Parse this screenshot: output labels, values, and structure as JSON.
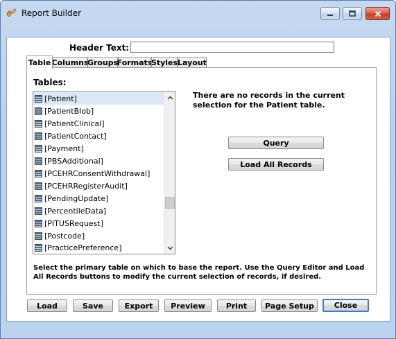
{
  "window": {
    "title": "Report Builder"
  },
  "header": {
    "label": "Header Text:",
    "value": ""
  },
  "tabs": [
    {
      "label": "Table",
      "active": true
    },
    {
      "label": "Columns",
      "active": false
    },
    {
      "label": "Groups",
      "active": false
    },
    {
      "label": "Formats",
      "active": false
    },
    {
      "label": "Styles",
      "active": false
    },
    {
      "label": "Layout",
      "active": false
    }
  ],
  "table_tab": {
    "tables_label": "Tables:",
    "tables": [
      "[Patient]",
      "[PatientBlob]",
      "[PatientClinical]",
      "[PatientContact]",
      "[Payment]",
      "[PBSAdditional]",
      "[PCEHRConsentWithdrawal]",
      "[PCEHRRegisterAudit]",
      "[PendingUpdate]",
      "[PercentileData]",
      "[PITUSRequest]",
      "[Postcode]",
      "[PracticePreference]"
    ],
    "selected_table": "[Patient]",
    "info_message": "There are no records in the current selection for the Patient table.",
    "query_button": "Query",
    "load_all_button": "Load All Records",
    "help_text": "Select the primary table on which to base the report. Use the Query Editor and Load All Records buttons to modify the current selection of records, if desired."
  },
  "footer_buttons": {
    "load": "Load",
    "save": "Save",
    "export": "Export",
    "preview": "Preview",
    "print": "Print",
    "page_setup": "Page Setup",
    "close": "Close"
  },
  "icons": {
    "app": "report-builder-icon",
    "table": "table-icon"
  },
  "colors": {
    "selection": "#dbe8f6",
    "default_button_border": "#3d7bd9",
    "close_button": "#c73c22"
  }
}
